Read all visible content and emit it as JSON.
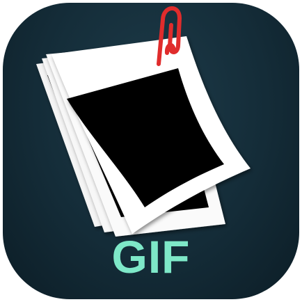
{
  "icon": {
    "label": "GIF",
    "icons": [
      "photo-stack-icon",
      "paperclip-icon"
    ],
    "colors": {
      "background": "#142c38",
      "label": "#7ee8c8",
      "photo_frame": "#ffffff",
      "photo_inner": "#000000",
      "paperclip": "#e03030"
    }
  }
}
